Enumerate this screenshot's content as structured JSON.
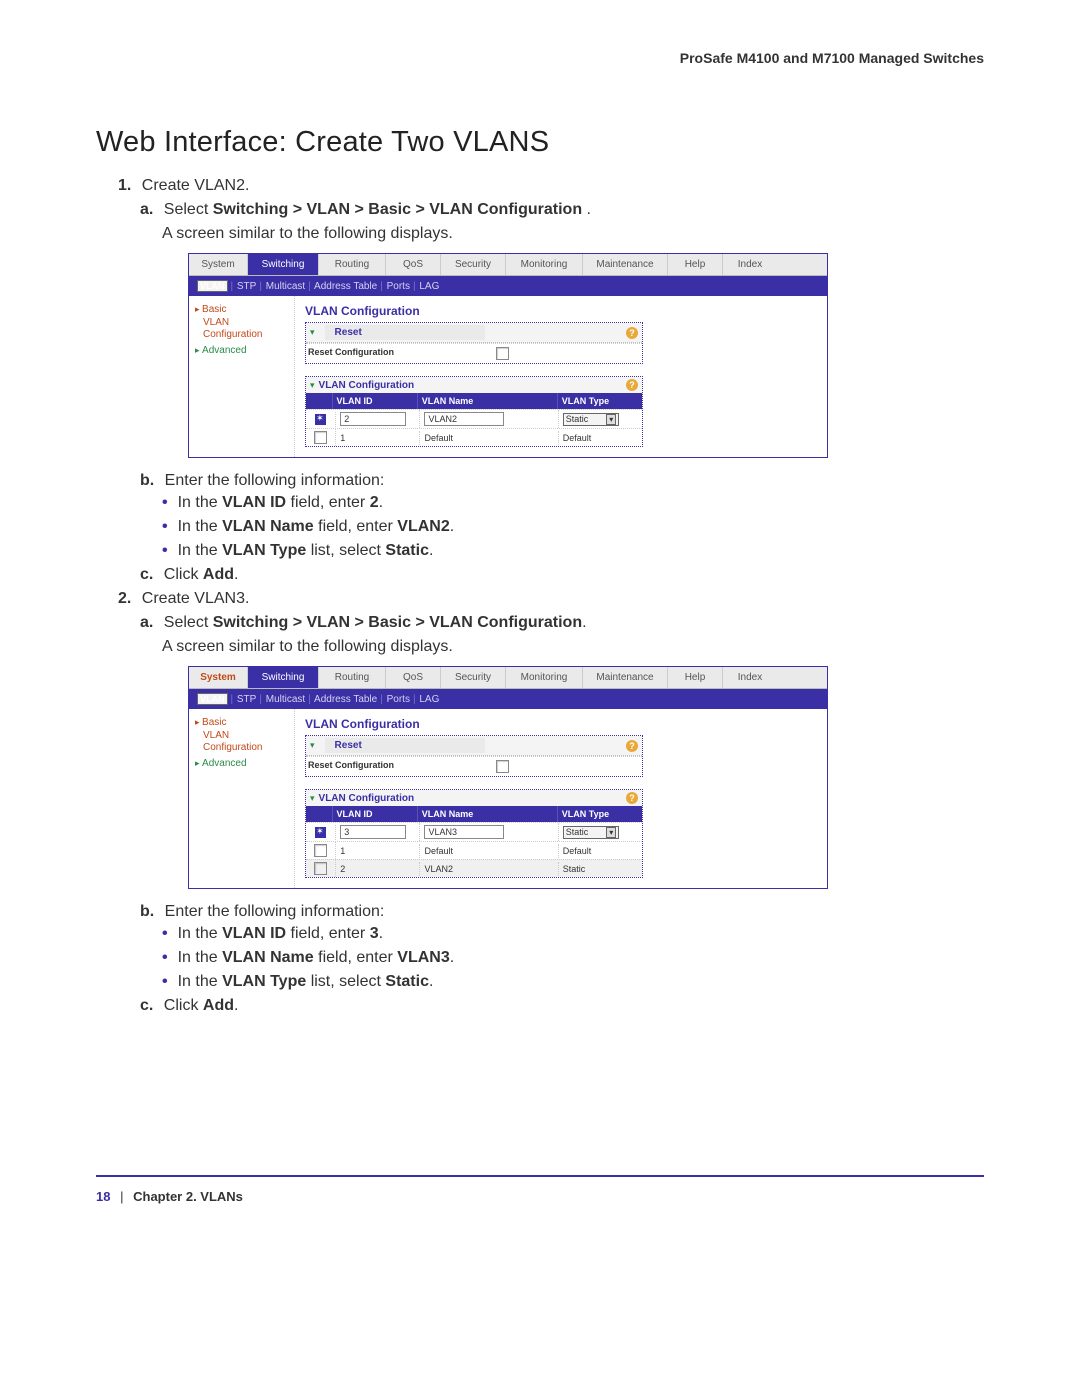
{
  "header": {
    "product": "ProSafe M4100 and M7100 Managed Switches"
  },
  "title": "Web Interface: Create Two VLANS",
  "step1": {
    "num": "1.",
    "text": "Create VLAN2.",
    "a_lbl": "a.",
    "a_prefix": "Select ",
    "a_bold": "Switching > VLAN > Basic > VLAN Configuration",
    "a_suffix": ".",
    "a_desc": "A screen similar to the following displays.",
    "b_lbl": "b.",
    "b_text": "Enter the following information:",
    "b1_pre": "In the ",
    "b1_bold": "VLAN ID",
    "b1_mid": " field, enter ",
    "b1_val": "2",
    "b1_end": ".",
    "b2_pre": "In the ",
    "b2_bold": "VLAN Name",
    "b2_mid": " field, enter ",
    "b2_val": "VLAN2",
    "b2_end": ".",
    "b3_pre": "In the ",
    "b3_bold": "VLAN Type",
    "b3_mid": " list, select ",
    "b3_val": "Static",
    "b3_end": ".",
    "c_lbl": "c.",
    "c_pre": "Click ",
    "c_bold": "Add",
    "c_end": "."
  },
  "step2": {
    "num": "2.",
    "text": "Create VLAN3.",
    "a_lbl": "a.",
    "a_prefix": "Select ",
    "a_bold": "Switching > VLAN > Basic > VLAN Configuration",
    "a_suffix": ".",
    "a_desc": "A screen similar to the following displays.",
    "b_lbl": "b.",
    "b_text": "Enter the following information:",
    "b1_pre": "In the ",
    "b1_bold": "VLAN ID",
    "b1_mid": " field, enter ",
    "b1_val": "3",
    "b1_end": ".",
    "b2_pre": "In the ",
    "b2_bold": "VLAN Name",
    "b2_mid": " field, enter ",
    "b2_val": "VLAN3",
    "b2_end": ".",
    "b3_pre": "In the ",
    "b3_bold": "VLAN Type",
    "b3_mid": " list, select ",
    "b3_val": "Static",
    "b3_end": ".",
    "c_lbl": "c.",
    "c_pre": "Click ",
    "c_bold": "Add",
    "c_end": "."
  },
  "tabs": {
    "system": "System",
    "switching": "Switching",
    "routing": "Routing",
    "qos": "QoS",
    "security": "Security",
    "monitoring": "Monitoring",
    "maintenance": "Maintenance",
    "help": "Help",
    "index": "Index"
  },
  "subtabs": {
    "vlan": "VLAN",
    "stp": "STP",
    "multicast": "Multicast",
    "addr": "Address Table",
    "ports": "Ports",
    "lag": "LAG"
  },
  "sidebar": {
    "basic": "Basic",
    "vlan_cfg_1": "VLAN",
    "vlan_cfg_2": "Configuration",
    "advanced": "Advanced"
  },
  "vlan_section_title": "VLAN Configuration",
  "reset": {
    "btn": "Reset",
    "label": "Reset Configuration"
  },
  "vcfg": {
    "title": "VLAN Configuration",
    "id": "VLAN ID",
    "name": "VLAN Name",
    "type": "VLAN Type"
  },
  "shot1": {
    "input_id": "2",
    "input_name": "VLAN2",
    "input_type": "Static",
    "rows": [
      {
        "id": "1",
        "name": "Default",
        "type": "Default"
      }
    ]
  },
  "shot2": {
    "input_id": "3",
    "input_name": "VLAN3",
    "input_type": "Static",
    "rows": [
      {
        "id": "1",
        "name": "Default",
        "type": "Default"
      },
      {
        "id": "2",
        "name": "VLAN2",
        "type": "Static"
      }
    ]
  },
  "footer": {
    "page": "18",
    "sep": "|",
    "chapter": "Chapter 2.  VLANs"
  }
}
